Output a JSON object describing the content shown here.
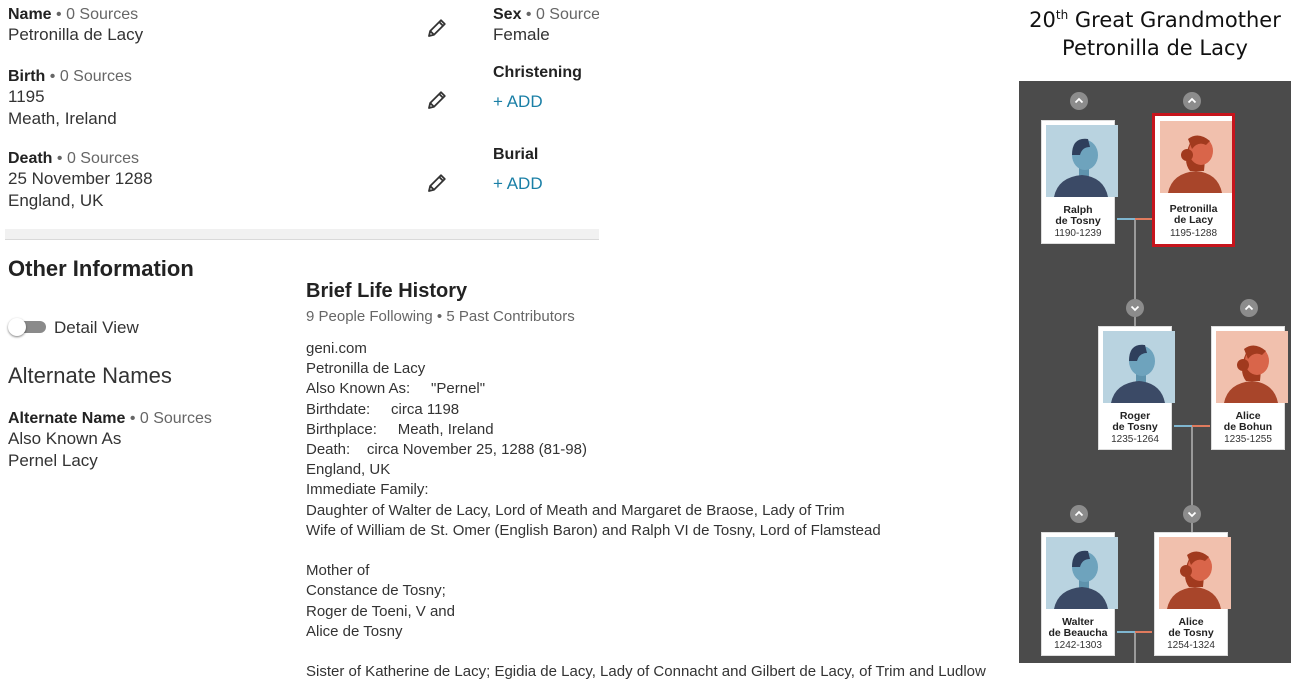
{
  "vitals": {
    "name": {
      "label": "Name",
      "sources": " • 0 Sources",
      "value": "Petronilla de Lacy"
    },
    "birth": {
      "label": "Birth",
      "sources": " • 0 Sources",
      "date": "1195",
      "place": "Meath, Ireland"
    },
    "death": {
      "label": "Death",
      "sources": " • 0 Sources",
      "date": "25 November 1288",
      "place": "England, UK"
    },
    "sex": {
      "label": "Sex",
      "sources": " • 0 Source",
      "value": "Female"
    },
    "christening": {
      "label": "Christening",
      "add": "+  ADD"
    },
    "burial": {
      "label": "Burial",
      "add": "+  ADD"
    }
  },
  "other_info": {
    "title": "Other Information",
    "detail_view_label": "Detail View",
    "alternate_names_title": "Alternate Names",
    "alternate_name": {
      "label": "Alternate Name",
      "sources": " • 0 Sources",
      "type": "Also Known As",
      "value": "Pernel Lacy"
    }
  },
  "life_history": {
    "title": "Brief Life History",
    "meta": "9 People Following • 5 Past Contributors",
    "lines": [
      "geni.com",
      "Petronilla de Lacy",
      "Also Known As:     \"Pernel\"",
      "Birthdate:     circa 1198",
      "Birthplace:     Meath, Ireland",
      "Death:    circa November 25, 1288 (81-98)",
      "England, UK",
      "Immediate Family:",
      "Daughter of Walter de Lacy, Lord of Meath and Margaret de Braose, Lady of Trim",
      "Wife of William de St. Omer (English Baron) and Ralph VI de Tosny, Lord of Flamstead",
      "",
      "Mother of",
      "Constance de Tosny;",
      "Roger de Toeni, V and",
      "Alice de Tosny",
      "",
      "Sister of Katherine de Lacy; Egidia de Lacy, Lady of Connacht and Gilbert de Lacy, of Trim and Ludlow"
    ]
  },
  "tree": {
    "title_ordinal": "20",
    "title_sup": "th",
    "title_rest": " Great Grandmother",
    "title_name": "Petronilla de Lacy",
    "people": [
      {
        "name1": "Ralph",
        "name2": "de Tosny",
        "years": "1190-1239",
        "gender": "male"
      },
      {
        "name1": "Petronilla",
        "name2": "de Lacy",
        "years": "1195-1288",
        "gender": "female"
      },
      {
        "name1": "Roger",
        "name2": "de Tosny",
        "years": "1235-1264",
        "gender": "male"
      },
      {
        "name1": "Alice",
        "name2": "de Bohun",
        "years": "1235-1255",
        "gender": "female"
      },
      {
        "name1": "Walter",
        "name2": "de Beaucha",
        "years": "1242-1303",
        "gender": "male"
      },
      {
        "name1": "Alice",
        "name2": "de Tosny",
        "years": "1254-1324",
        "gender": "female"
      }
    ],
    "colors": {
      "background": "#4b4b4b",
      "male_bg": "#b9d3e0",
      "female_bg": "#f1c0ad",
      "selected_border": "#c6141c"
    }
  }
}
